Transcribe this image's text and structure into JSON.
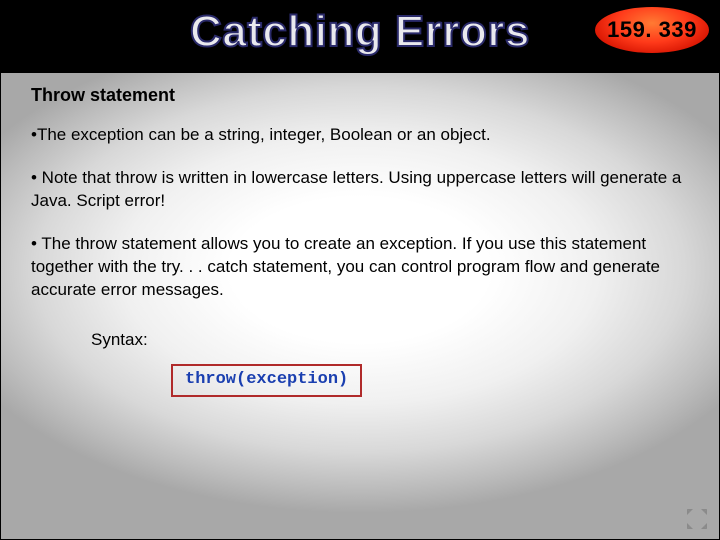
{
  "header": {
    "title": "Catching Errors",
    "badge": "159. 339"
  },
  "body": {
    "subtitle": "Throw statement",
    "bullets": [
      "•The exception can be a string, integer, Boolean or an object.",
      "• Note that throw is written in lowercase letters. Using uppercase letters will generate a Java. Script error!",
      "• The throw statement allows you to create an exception. If you use this statement together with the try. . . catch statement, you can control program flow and generate accurate error messages."
    ],
    "syntax_label": "Syntax:",
    "code": "throw(exception)"
  }
}
